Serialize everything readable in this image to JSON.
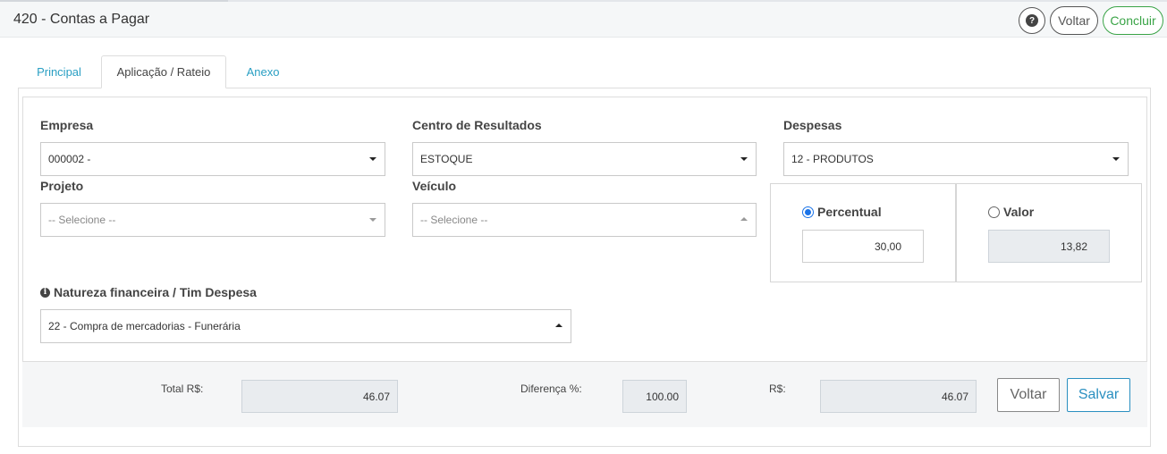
{
  "header": {
    "title": "420 - Contas a Pagar",
    "help_icon": "question-circle-icon",
    "help_glyph": "?",
    "voltar_label": "Voltar",
    "concluir_label": "Concluir",
    "concluir_color": "#3aa447"
  },
  "tabs": [
    {
      "label": "Principal",
      "active": false
    },
    {
      "label": "Aplicação / Rateio",
      "active": true
    },
    {
      "label": "Anexo",
      "active": false
    }
  ],
  "form": {
    "empresa": {
      "label": "Empresa",
      "value": "000002 -"
    },
    "centro": {
      "label": "Centro de Resultados",
      "value": "ESTOQUE"
    },
    "despesas": {
      "label": "Despesas",
      "value": "12 - PRODUTOS"
    },
    "projeto": {
      "label": "Projeto",
      "placeholder": "-- Selecione --"
    },
    "veiculo": {
      "label": "Veículo",
      "placeholder": "-- Selecione --"
    },
    "natureza": {
      "label": "Natureza financeira / Tim Despesa",
      "info_icon": "info-circle-icon",
      "info_glyph": "i",
      "value": "22 - Compra de mercadorias - Funerária"
    },
    "percentual": {
      "label": "Percentual",
      "checked": true,
      "value": "30,00"
    },
    "valor": {
      "label": "Valor",
      "checked": false,
      "value": "13,82"
    }
  },
  "footer": {
    "total_label": "Total R$:",
    "total_value": "46.07",
    "diferenca_label": "Diferença %:",
    "diferenca_value": "100.00",
    "rs_label": "R$:",
    "rs_value": "46.07",
    "voltar_label": "Voltar",
    "salvar_label": "Salvar",
    "salvar_color": "#2a8fc0"
  }
}
